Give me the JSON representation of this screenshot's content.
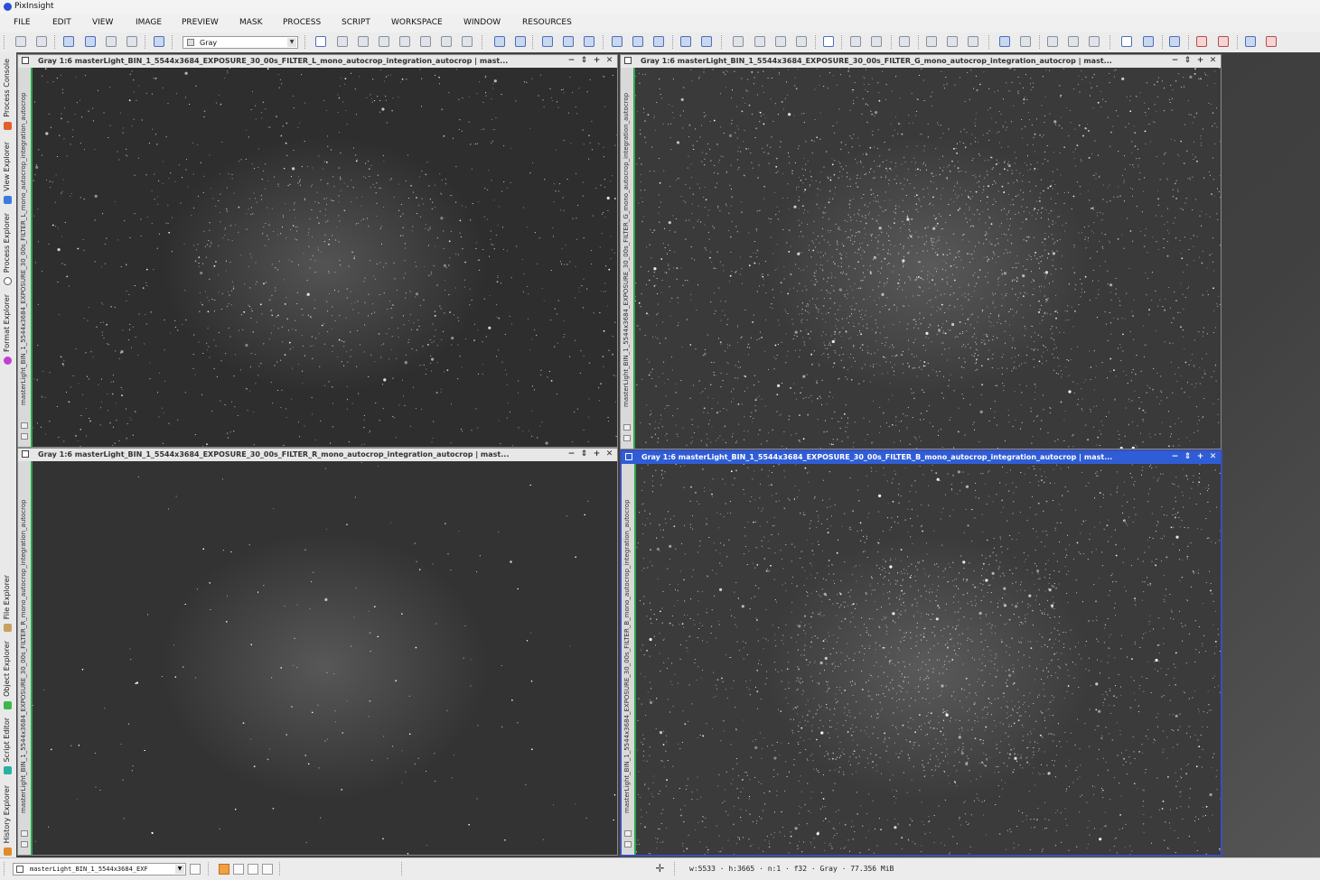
{
  "app": {
    "title": "PixInsight"
  },
  "menu": [
    "FILE",
    "EDIT",
    "VIEW",
    "IMAGE",
    "PREVIEW",
    "MASK",
    "PROCESS",
    "SCRIPT",
    "WORKSPACE",
    "WINDOW",
    "RESOURCES"
  ],
  "toolbar": {
    "colorspace_value": "Gray"
  },
  "left_tabs": [
    "Process Console",
    "View Explorer",
    "Process Explorer",
    "Format Explorer",
    "File Explorer",
    "Object Explorer",
    "Script Editor",
    "History Explorer"
  ],
  "windows": [
    {
      "title": "Gray 1:6 masterLight_BIN_1_5544x3684_EXPOSURE_30_00s_FILTER_L_mono_autocrop_integration_autocrop | mast...",
      "side_label": "masterLight_BIN_1_5544x3684_EXPOSURE_30_00s_FILTER_L_mono_autocrop_integration_autocrop",
      "active": false
    },
    {
      "title": "Gray 1:6 masterLight_BIN_1_5544x3684_EXPOSURE_30_00s_FILTER_G_mono_autocrop_integration_autocrop | mast...",
      "side_label": "masterLight_BIN_1_5544x3684_EXPOSURE_30_00s_FILTER_G_mono_autocrop_integration_autocrop",
      "active": false
    },
    {
      "title": "Gray 1:6 masterLight_BIN_1_5544x3684_EXPOSURE_30_00s_FILTER_R_mono_autocrop_integration_autocrop | mast...",
      "side_label": "masterLight_BIN_1_5544x3684_EXPOSURE_30_00s_FILTER_R_mono_autocrop_integration_autocrop",
      "active": false
    },
    {
      "title": "Gray 1:6 masterLight_BIN_1_5544x3684_EXPOSURE_30_00s_FILTER_B_mono_autocrop_integration_autocrop | mast...",
      "side_label": "masterLight_BIN_1_5544x3684_EXPOSURE_30_00s_FILTER_B_mono_autocrop_integration_autocrop",
      "active": true
    }
  ],
  "status": {
    "view_selector": "masterLight_BIN_1_5544x3684_EXF",
    "image_info": "w:5533 · h:3665 · n:1 · f32 · Gray · 77.356 MiB"
  },
  "colors": {
    "active_titlebar": "#2f5dd6",
    "active_border": "#3a50b4",
    "window_accent": "#2aa84a"
  }
}
